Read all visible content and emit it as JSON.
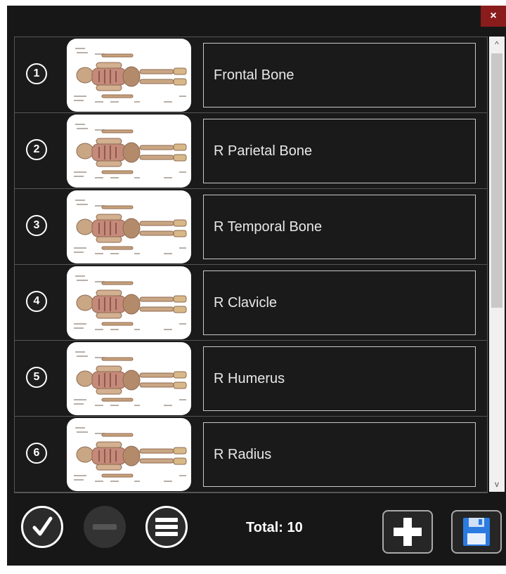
{
  "window": {
    "close_label": "×"
  },
  "list": {
    "items": [
      {
        "number": "1",
        "name": "Frontal Bone"
      },
      {
        "number": "2",
        "name": "R Parietal Bone"
      },
      {
        "number": "3",
        "name": "R Temporal Bone"
      },
      {
        "number": "4",
        "name": "R Clavicle"
      },
      {
        "number": "5",
        "name": "R Humerus"
      },
      {
        "number": "6",
        "name": "R Radius"
      }
    ]
  },
  "scrollbar": {
    "up_icon": "^",
    "down_icon": "v"
  },
  "footer": {
    "total": "Total: 10"
  },
  "colors": {
    "background": "#171717",
    "close": "#8a1c1c",
    "save_icon": "#2b7be0"
  },
  "icons": [
    "check-icon",
    "minus-icon",
    "menu-icon",
    "plus-icon",
    "save-icon",
    "skeleton-thumbnail"
  ]
}
